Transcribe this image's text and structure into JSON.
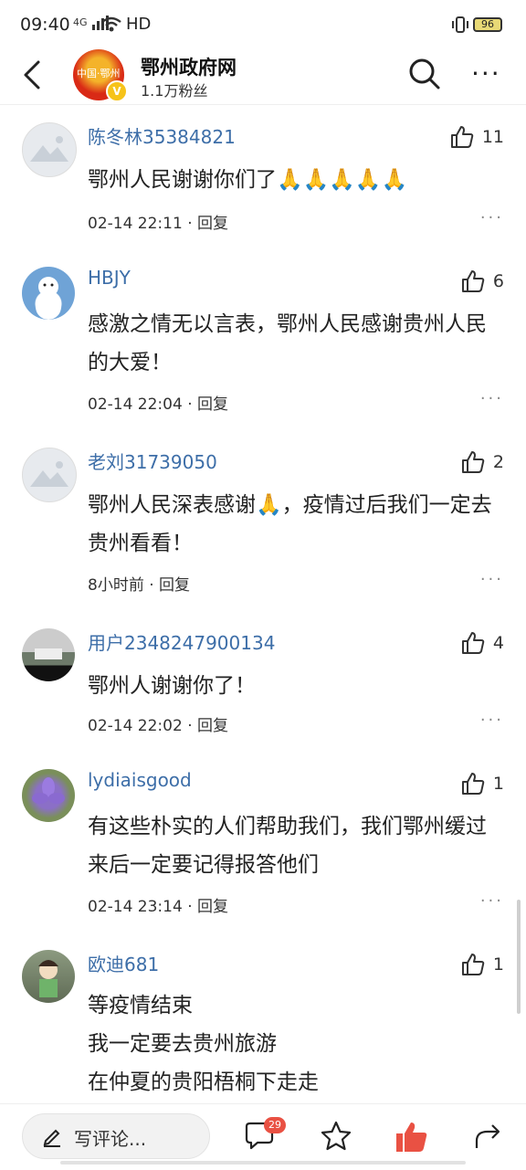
{
  "status": {
    "time": "09:40",
    "network": "4G",
    "hd": "HD",
    "battery": "96"
  },
  "header": {
    "account_name": "鄂州政府网",
    "fans": "1.1万粉丝",
    "avatar_text": "中国·鄂州",
    "verify_badge": "V"
  },
  "comments": [
    {
      "user": "陈冬林35384821",
      "likes": "11",
      "text": "鄂州人民谢谢你们了🙏🙏🙏🙏🙏",
      "time": "02-14 22:11",
      "reply": "回复"
    },
    {
      "user": "HBJY",
      "likes": "6",
      "text": "感激之情无以言表，鄂州人民感谢贵州人民的大爱！",
      "time": "02-14 22:04",
      "reply": "回复"
    },
    {
      "user": "老刘31739050",
      "likes": "2",
      "text": "鄂州人民深表感谢🙏，疫情过后我们一定去贵州看看！",
      "time": "8小时前",
      "reply": "回复"
    },
    {
      "user": "用户2348247900134",
      "likes": "4",
      "text": "鄂州人谢谢你了！",
      "time": "02-14 22:02",
      "reply": "回复"
    },
    {
      "user": "lydiaisgood",
      "likes": "1",
      "text": "有这些朴实的人们帮助我们，我们鄂州缓过来后一定要记得报答他们",
      "time": "02-14 23:14",
      "reply": "回复"
    },
    {
      "user": "欧迪681",
      "likes": "1",
      "text": "等疫情结束\n我一定要去贵州旅游\n在仲夏的贵阳梧桐下走走",
      "time": "",
      "reply": ""
    }
  ],
  "bottom": {
    "comment_placeholder": "写评论...",
    "comment_count": "29"
  },
  "colors": {
    "username": "#3d6ea8",
    "like_active": "#e95143"
  },
  "icons": [
    "back-arrow-icon",
    "search-icon",
    "more-icon",
    "thumbs-up-icon",
    "pen-icon",
    "comment-bubble-icon",
    "star-icon",
    "share-icon"
  ]
}
